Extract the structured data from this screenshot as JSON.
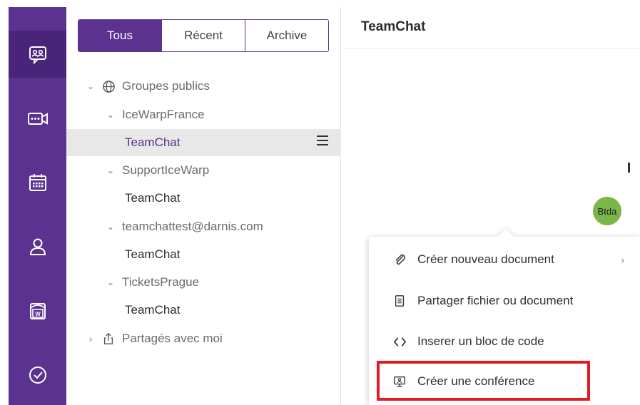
{
  "rail": {
    "items": [
      {
        "name": "chat",
        "icon": "chat-bubbles-icon",
        "active": true
      },
      {
        "name": "conference",
        "icon": "video-camera-icon",
        "active": false
      },
      {
        "name": "calendar",
        "icon": "calendar-icon",
        "active": false
      },
      {
        "name": "contacts",
        "icon": "person-icon",
        "active": false
      },
      {
        "name": "documents",
        "icon": "word-document-icon",
        "active": false
      },
      {
        "name": "tasks",
        "icon": "check-circle-icon",
        "active": false
      }
    ]
  },
  "filters": {
    "all": "Tous",
    "recent": "Récent",
    "archive": "Archive"
  },
  "tree": {
    "public_groups": "Groupes publics",
    "groups": [
      {
        "name": "IceWarpFrance",
        "channel": "TeamChat"
      },
      {
        "name": "SupportIceWarp",
        "channel": "TeamChat"
      },
      {
        "name": "teamchattest@darnis.com",
        "channel": "TeamChat"
      },
      {
        "name": "TicketsPrague",
        "channel": "TeamChat"
      }
    ],
    "shared_with_me": "Partagés avec moi"
  },
  "chat": {
    "title": "TeamChat",
    "avatar_initials": "Btda"
  },
  "context_menu": {
    "items": [
      {
        "label": "Créer nouveau document",
        "icon": "paperclip-icon"
      },
      {
        "label": "Partager fichier ou document",
        "icon": "file-icon"
      },
      {
        "label": "Inserer un bloc de code",
        "icon": "code-brackets-icon"
      },
      {
        "label": "Créer une conférence",
        "icon": "conference-screen-icon"
      }
    ]
  },
  "colors": {
    "brand": "#5b3290",
    "rail_active": "#4a2478",
    "avatar": "#7ab648",
    "highlight": "#e21b23"
  }
}
